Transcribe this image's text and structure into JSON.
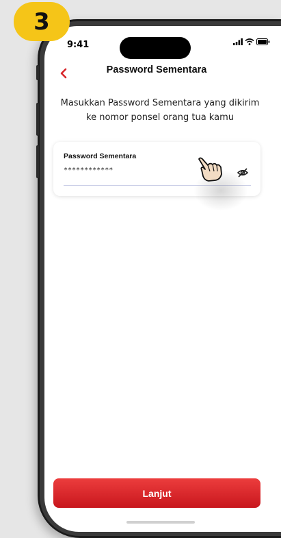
{
  "step": {
    "number": "3"
  },
  "status_bar": {
    "time": "9:41",
    "icons": [
      "signal-icon",
      "wifi-icon",
      "battery-icon"
    ]
  },
  "header": {
    "back_icon": "chevron-left-icon",
    "title": "Password Sementara"
  },
  "instruction": "Masukkan Password Sementara yang dikirim ke nomor ponsel orang tua kamu",
  "password_field": {
    "label": "Password Sementara",
    "value": "************",
    "toggle_icon": "eye-slash-icon"
  },
  "overlay": {
    "pointer_icon": "hand-pointer-icon"
  },
  "cta": {
    "label": "Lanjut"
  },
  "colors": {
    "accent": "#d7262b",
    "badge": "#f5c518",
    "underline": "#c9cde6"
  }
}
